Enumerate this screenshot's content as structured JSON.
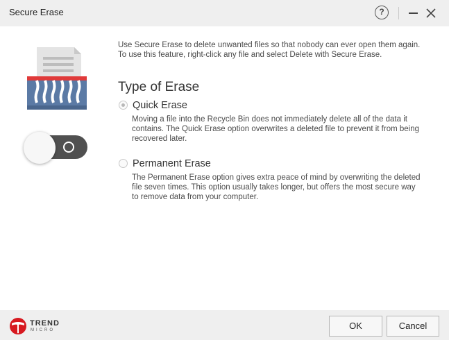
{
  "window": {
    "title": "Secure Erase",
    "help_glyph": "?"
  },
  "intro": "Use Secure Erase to delete unwanted files so that nobody can ever open them again. To use this feature, right-click any file and select Delete with Secure Erase.",
  "section_title": "Type of Erase",
  "options": [
    {
      "label": "Quick Erase",
      "checked": true,
      "description": "Moving a file into the Recycle Bin does not immediately delete all of the data it contains. The Quick Erase option overwrites a deleted file to prevent it from being recovered later."
    },
    {
      "label": "Permanent Erase",
      "checked": false,
      "description": "The Permanent Erase option gives extra peace of mind by overwriting the deleted file seven times. This option usually takes longer, but offers the most secure way to remove data from your computer."
    }
  ],
  "toggle": {
    "state": "off"
  },
  "brand": {
    "line1": "TREND",
    "line2": "MICRO",
    "color": "#d71920"
  },
  "buttons": {
    "ok": "OK",
    "cancel": "Cancel"
  },
  "colors": {
    "shredder_blue": "#5b7aa5",
    "shredder_red": "#e03a3a",
    "toggle_track": "#505050"
  }
}
